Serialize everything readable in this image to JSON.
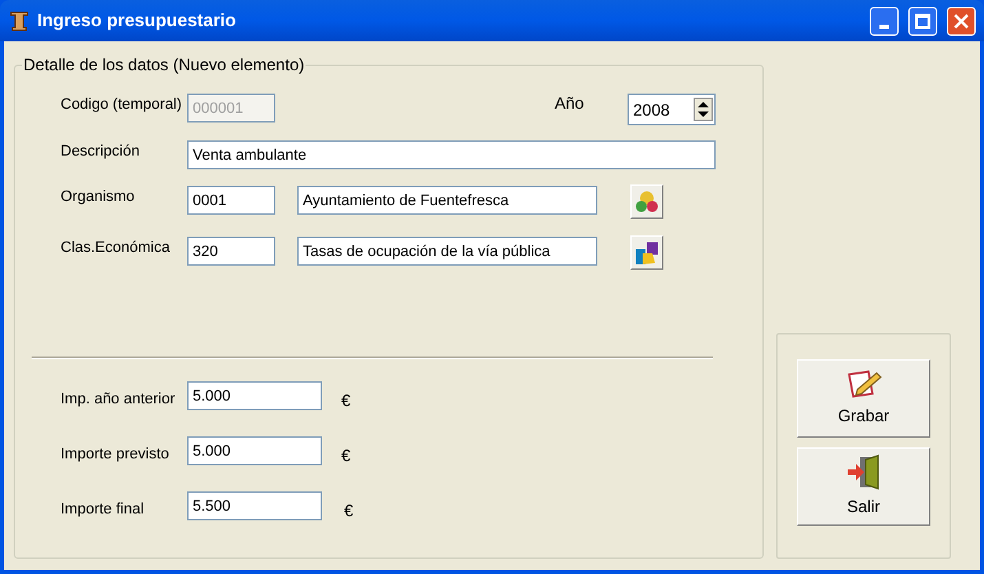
{
  "window": {
    "title": "Ingreso presupuestario"
  },
  "group": {
    "legend": "Detalle de los datos (Nuevo elemento)"
  },
  "codigo": {
    "label": "Codigo (temporal)",
    "value": "000001",
    "disabled": true
  },
  "anio": {
    "label": "Año",
    "value": "2008"
  },
  "descripcion": {
    "label": "Descripción",
    "value": "Venta ambulante"
  },
  "organismo": {
    "label": "Organismo",
    "code": "0001",
    "name": "Ayuntamiento de Fuentefresca"
  },
  "clasificacion": {
    "label": "Clas.Económica",
    "code": "320",
    "name": "Tasas de ocupación de la vía pública"
  },
  "amounts": [
    {
      "label": "Imp. año anterior",
      "value": "5.000",
      "currency": "€"
    },
    {
      "label": "Importe previsto",
      "value": "5.000",
      "currency": "€"
    },
    {
      "label": "Importe final",
      "value": "5.500",
      "currency": "€"
    }
  ],
  "buttons": [
    {
      "kind": "save",
      "label": "Grabar"
    },
    {
      "kind": "exit",
      "label": "Salir"
    }
  ]
}
